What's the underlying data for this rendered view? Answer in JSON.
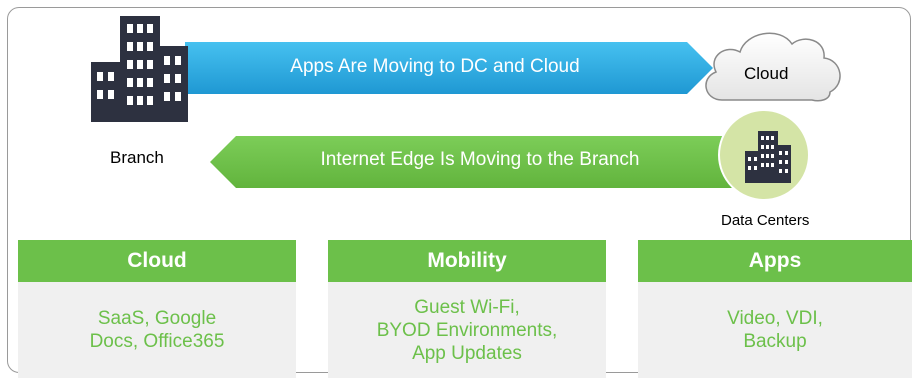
{
  "top_arrow": {
    "label": "Apps Are Moving to DC and Cloud"
  },
  "bottom_arrow": {
    "label": "Internet Edge Is Moving to the Branch"
  },
  "branch": {
    "label": "Branch",
    "icon": "building-icon"
  },
  "cloud": {
    "label": "Cloud",
    "icon": "cloud-icon"
  },
  "data_centers": {
    "label": "Data Centers",
    "icon": "data-center-icon"
  },
  "cards": [
    {
      "title": "Cloud",
      "lines": [
        "SaaS, Google",
        "Docs, Office365"
      ]
    },
    {
      "title": "Mobility",
      "lines": [
        "Guest Wi-Fi,",
        "BYOD Environments,",
        "App Updates"
      ]
    },
    {
      "title": "Apps",
      "lines": [
        "Video, VDI,",
        "Backup"
      ]
    }
  ],
  "colors": {
    "accent_green": "#6cc04a",
    "arrow_blue": "#29a8e0",
    "building_dark": "#2d3140",
    "panel_gray": "#f0f0f0",
    "dc_circle": "#d4e4a6"
  }
}
